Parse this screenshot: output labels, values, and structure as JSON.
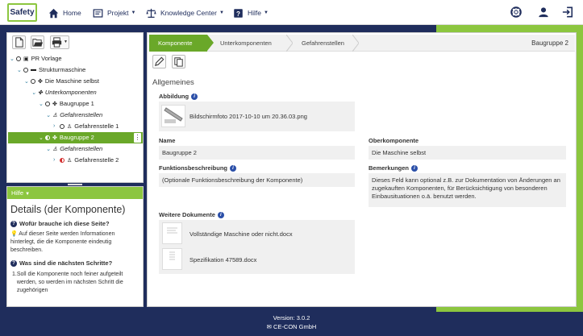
{
  "nav": {
    "logo": "Safety",
    "home": "Home",
    "projekt": "Projekt",
    "knowledge": "Knowledge Center",
    "hilfe": "Hilfe"
  },
  "tree": [
    {
      "label": "PR Vorlage",
      "italic": false
    },
    {
      "label": "Strukturmaschine",
      "italic": false
    },
    {
      "label": "Die Maschine selbst",
      "italic": false
    },
    {
      "label": "Unterkomponenten",
      "italic": true
    },
    {
      "label": "Baugruppe 1",
      "italic": false
    },
    {
      "label": "Gefahrenstellen",
      "italic": true
    },
    {
      "label": "Gefahrenstelle 1",
      "italic": false
    },
    {
      "label": "Baugruppe 2",
      "italic": false
    },
    {
      "label": "Gefahrenstellen",
      "italic": true
    },
    {
      "label": "Gefahrenstelle 2",
      "italic": false
    }
  ],
  "help": {
    "header": "Hilfe",
    "title": "Details (der Komponente)",
    "q1": "Wofür brauche ich diese Seite?",
    "t1": "Auf dieser Seite werden Informationen hinterlegt, die die Komponente eindeutig beschreiben.",
    "q2": "Was sind die nächsten Schritte?",
    "l1num": "1.",
    "l1": "Soll die Komponente noch feiner aufgeteilt werden, so werden im nächsten Schritt die zugehörigen"
  },
  "tabs": {
    "t1": "Komponente",
    "t2": "Unterkomponenten",
    "t3": "Gefahrenstellen",
    "right": "Baugruppe 2"
  },
  "main": {
    "section": "Allgemeines",
    "abbildung_label": "Abbildung",
    "abbildung_file": "Bildschirmfoto 2017-10-10 um 20.36.03.png",
    "name_label": "Name",
    "name_value": "Baugruppe 2",
    "ober_label": "Oberkomponente",
    "ober_value": "Die Maschine selbst",
    "funk_label": "Funktionsbeschreibung",
    "funk_value": "(Optionale Funktionsbeschreibung der Komponente)",
    "bem_label": "Bemerkungen",
    "bem_value": "Dieses Feld kann optional z.B. zur Dokumentation von Änderungen an zugekauften Komponenten, für Berücksichtigung von besonderen Einbausituationen o.ä. benutzt werden.",
    "docs_label": "Weitere Dokumente",
    "doc1": "Vollständige Maschine oder nicht.docx",
    "doc2": "Spezifikation 47589.docx"
  },
  "footer": {
    "version": "Version: 3.0.2",
    "company": "CE-CON GmbH"
  },
  "colors": {
    "navy": "#1f2d5c",
    "green": "#8cc63f",
    "green_dark": "#6aa829",
    "info_blue": "#2b4fa8"
  }
}
